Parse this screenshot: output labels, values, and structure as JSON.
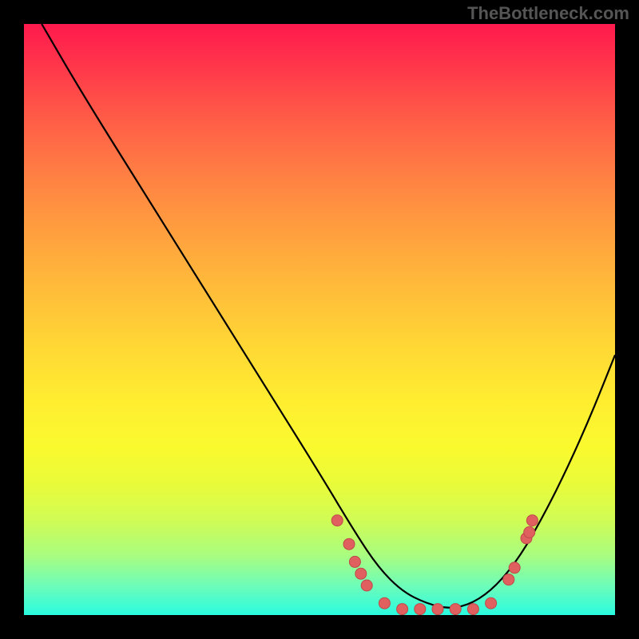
{
  "watermark": "TheBottleneck.com",
  "chart_data": {
    "type": "line",
    "title": "",
    "xlabel": "",
    "ylabel": "",
    "xlim": [
      0,
      100
    ],
    "ylim": [
      0,
      100
    ],
    "grid": false,
    "legend": false,
    "background": "rainbow-gradient-red-to-cyan",
    "series": [
      {
        "name": "bottleneck-curve",
        "x": [
          3,
          10,
          20,
          30,
          40,
          50,
          56,
          60,
          64,
          68,
          72,
          76,
          80,
          84,
          88,
          92,
          96,
          100
        ],
        "y": [
          100,
          88,
          72,
          56,
          40,
          24,
          14,
          8,
          4,
          2,
          1,
          2,
          5,
          10,
          17,
          25,
          34,
          44
        ]
      }
    ],
    "scatter_points": [
      {
        "x": 53,
        "y": 16
      },
      {
        "x": 55,
        "y": 12
      },
      {
        "x": 56,
        "y": 9
      },
      {
        "x": 57,
        "y": 7
      },
      {
        "x": 58,
        "y": 5
      },
      {
        "x": 61,
        "y": 2
      },
      {
        "x": 64,
        "y": 1
      },
      {
        "x": 67,
        "y": 1
      },
      {
        "x": 70,
        "y": 1
      },
      {
        "x": 73,
        "y": 1
      },
      {
        "x": 76,
        "y": 1
      },
      {
        "x": 79,
        "y": 2
      },
      {
        "x": 82,
        "y": 6
      },
      {
        "x": 83,
        "y": 8
      },
      {
        "x": 85,
        "y": 13
      },
      {
        "x": 85.5,
        "y": 14
      },
      {
        "x": 86,
        "y": 16
      }
    ]
  }
}
